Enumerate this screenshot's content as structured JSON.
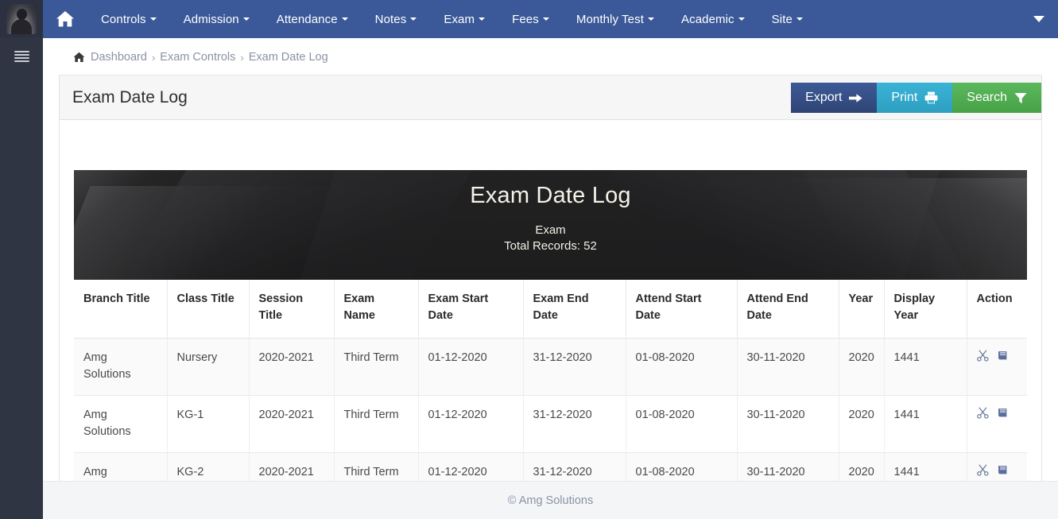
{
  "sidebar": {
    "avatar_name": "user-avatar",
    "toggle_name": "menu-toggle"
  },
  "navbar": {
    "home_label": "Home",
    "items": [
      {
        "label": "Controls",
        "has_caret": true
      },
      {
        "label": "Admission",
        "has_caret": true
      },
      {
        "label": "Attendance",
        "has_caret": true
      },
      {
        "label": "Notes",
        "has_caret": true
      },
      {
        "label": "Exam",
        "has_caret": true
      },
      {
        "label": "Fees",
        "has_caret": true
      },
      {
        "label": "Monthly Test",
        "has_caret": true
      },
      {
        "label": "Academic",
        "has_caret": true
      },
      {
        "label": "Site",
        "has_caret": true
      }
    ],
    "background_color": "#3b5998"
  },
  "breadcrumb": {
    "items": [
      "Dashboard",
      "Exam Controls",
      "Exam Date Log"
    ],
    "separator": "›"
  },
  "panel": {
    "title": "Exam Date Log",
    "buttons": [
      {
        "label": "Export",
        "icon": "arrow-right-icon",
        "color": "#3d5a97"
      },
      {
        "label": "Print",
        "icon": "printer-icon",
        "color": "#3ab3d6"
      },
      {
        "label": "Search",
        "icon": "filter-icon",
        "color": "#5cb85c"
      }
    ]
  },
  "banner": {
    "title": "Exam Date Log",
    "subtitle": "Exam",
    "total_records_label": "Total Records: 52"
  },
  "table": {
    "columns": [
      "Branch Title",
      "Class Title",
      "Session Title",
      "Exam Name",
      "Exam Start Date",
      "Exam End Date",
      "Attend Start Date",
      "Attend End Date",
      "Year",
      "Display Year",
      "Action"
    ],
    "rows": [
      {
        "branch_title": "Amg Solutions",
        "class_title": "Nursery",
        "session_title": "2020-2021",
        "exam_name": "Third Term",
        "exam_start_date": "01-12-2020",
        "exam_end_date": "31-12-2020",
        "attend_start_date": "01-08-2020",
        "attend_end_date": "30-11-2020",
        "year": "2020",
        "display_year": "1441"
      },
      {
        "branch_title": "Amg Solutions",
        "class_title": "KG-1",
        "session_title": "2020-2021",
        "exam_name": "Third Term",
        "exam_start_date": "01-12-2020",
        "exam_end_date": "31-12-2020",
        "attend_start_date": "01-08-2020",
        "attend_end_date": "30-11-2020",
        "year": "2020",
        "display_year": "1441"
      },
      {
        "branch_title": "Amg Solutions",
        "class_title": "KG-2",
        "session_title": "2020-2021",
        "exam_name": "Third Term",
        "exam_start_date": "01-12-2020",
        "exam_end_date": "31-12-2020",
        "attend_start_date": "01-08-2020",
        "attend_end_date": "30-11-2020",
        "year": "2020",
        "display_year": "1441"
      }
    ],
    "action_icons": [
      "scissors-icon",
      "book-icon"
    ]
  },
  "footer": {
    "text": "© Amg Solutions"
  }
}
